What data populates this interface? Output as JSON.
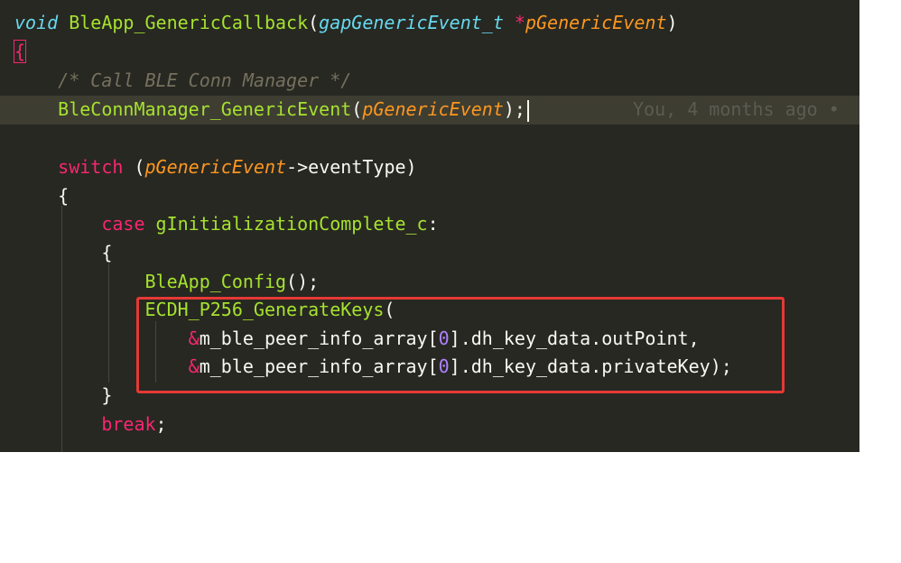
{
  "code": {
    "l1": {
      "kw": "void",
      "fn": "BleApp_GenericCallback",
      "p1": "(",
      "type": "gapGenericEvent_t",
      "ptr": "*",
      "param": "pGenericEvent",
      "p2": ")"
    },
    "l2": {
      "brace": "{"
    },
    "l3": {
      "comment": "/* Call BLE Conn Manager */"
    },
    "l4": {
      "fn": "BleConnManager_GenericEvent",
      "p1": "(",
      "param": "pGenericEvent",
      "p2": ");",
      "blame": "You, 4 months ago •"
    },
    "l6": {
      "kw": "switch",
      "p1": " (",
      "param": "pGenericEvent",
      "arrow": "->",
      "member": "eventType",
      "p2": ")"
    },
    "l7": {
      "brace": "{"
    },
    "l8": {
      "kw": "case",
      "label": "gInitializationComplete_c",
      "colon": ":"
    },
    "l9": {
      "brace": "{"
    },
    "l10": {
      "fn": "BleApp_Config",
      "p": "();"
    },
    "l11": {
      "fn": "ECDH_P256_GenerateKeys",
      "p": "("
    },
    "l12": {
      "amp": "&",
      "arr": "m_ble_peer_info_array",
      "lb": "[",
      "idx": "0",
      "rb": "]",
      "d1": ".",
      "m1": "dh_key_data",
      "d2": ".",
      "m2": "outPoint",
      "end": ","
    },
    "l13": {
      "amp": "&",
      "arr": "m_ble_peer_info_array",
      "lb": "[",
      "idx": "0",
      "rb": "]",
      "d1": ".",
      "m1": "dh_key_data",
      "d2": ".",
      "m2": "privateKey",
      "end": ");"
    },
    "l14": {
      "brace": "}"
    },
    "l15": {
      "kw": "break",
      "end": ";"
    }
  },
  "colors": {
    "background": "#272822",
    "highlight_box": "#e53935"
  }
}
